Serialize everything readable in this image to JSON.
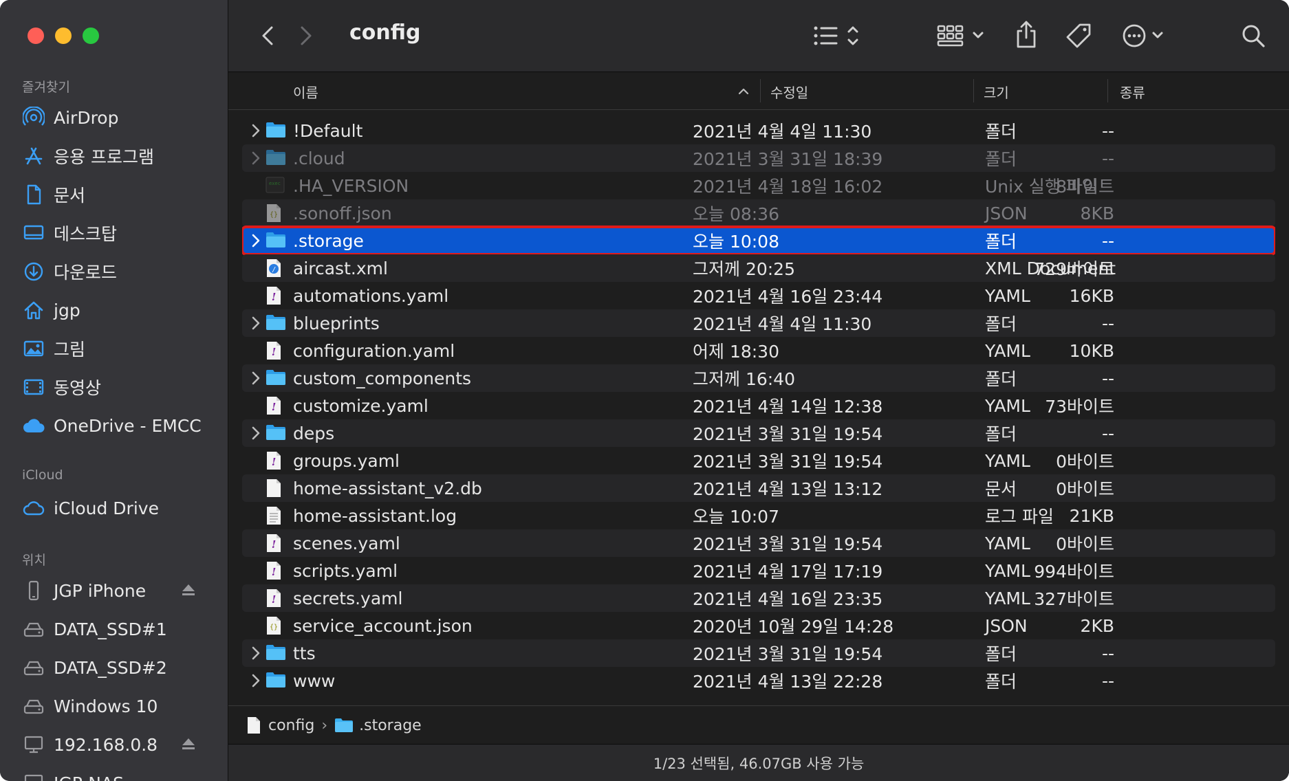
{
  "window": {
    "title": "config"
  },
  "sidebar": {
    "favorites_label": "즐겨찾기",
    "favorites": [
      {
        "label": "AirDrop",
        "icon": "airdrop-icon"
      },
      {
        "label": "응용 프로그램",
        "icon": "applications-icon"
      },
      {
        "label": "문서",
        "icon": "document-icon"
      },
      {
        "label": "데스크탑",
        "icon": "desktop-icon"
      },
      {
        "label": "다운로드",
        "icon": "download-icon"
      },
      {
        "label": "jgp",
        "icon": "home-icon"
      },
      {
        "label": "그림",
        "icon": "pictures-icon"
      },
      {
        "label": "동영상",
        "icon": "movies-icon"
      },
      {
        "label": "OneDrive - EMCC",
        "icon": "cloud-icon"
      }
    ],
    "icloud_label": "iCloud",
    "icloud": [
      {
        "label": "iCloud Drive",
        "icon": "icloud-icon"
      }
    ],
    "locations_label": "위치",
    "locations": [
      {
        "label": "JGP iPhone",
        "icon": "iphone-icon",
        "eject": true
      },
      {
        "label": "DATA_SSD#1",
        "icon": "drive-icon"
      },
      {
        "label": "DATA_SSD#2",
        "icon": "drive-icon"
      },
      {
        "label": "Windows 10",
        "icon": "drive-icon"
      },
      {
        "label": "192.168.0.8",
        "icon": "server-icon",
        "eject": true
      },
      {
        "label": "JGP-NAS",
        "icon": "server-icon"
      }
    ]
  },
  "columns": {
    "name": "이름",
    "date": "수정일",
    "size": "크기",
    "kind": "종류"
  },
  "files": [
    {
      "name": "!Default",
      "date": "2021년 4월 4일 11:30",
      "size": "--",
      "kind": "폴더",
      "type": "folder"
    },
    {
      "name": ".cloud",
      "date": "2021년 3월 31일 18:39",
      "size": "--",
      "kind": "폴더",
      "type": "folder",
      "dim": true
    },
    {
      "name": ".HA_VERSION",
      "date": "2021년 4월 18일 16:02",
      "size": "8바이트",
      "kind": "Unix 실행 파일",
      "type": "exec",
      "dim": true
    },
    {
      "name": ".sonoff.json",
      "date": "오늘 08:36",
      "size": "8KB",
      "kind": "JSON",
      "type": "json",
      "dim": true
    },
    {
      "name": ".storage",
      "date": "오늘 10:08",
      "size": "--",
      "kind": "폴더",
      "type": "folder",
      "selected": true
    },
    {
      "name": "aircast.xml",
      "date": "그저께 20:25",
      "size": "729바이트",
      "kind": "XML Document",
      "type": "xml"
    },
    {
      "name": "automations.yaml",
      "date": "2021년 4월 16일 23:44",
      "size": "16KB",
      "kind": "YAML",
      "type": "yaml"
    },
    {
      "name": "blueprints",
      "date": "2021년 4월 4일 11:30",
      "size": "--",
      "kind": "폴더",
      "type": "folder"
    },
    {
      "name": "configuration.yaml",
      "date": "어제 18:30",
      "size": "10KB",
      "kind": "YAML",
      "type": "yaml"
    },
    {
      "name": "custom_components",
      "date": "그저께 16:40",
      "size": "--",
      "kind": "폴더",
      "type": "folder"
    },
    {
      "name": "customize.yaml",
      "date": "2021년 4월 14일 12:38",
      "size": "73바이트",
      "kind": "YAML",
      "type": "yaml"
    },
    {
      "name": "deps",
      "date": "2021년 3월 31일 19:54",
      "size": "--",
      "kind": "폴더",
      "type": "folder"
    },
    {
      "name": "groups.yaml",
      "date": "2021년 3월 31일 19:54",
      "size": "0바이트",
      "kind": "YAML",
      "type": "yaml"
    },
    {
      "name": "home-assistant_v2.db",
      "date": "2021년 4월 13일 13:12",
      "size": "0바이트",
      "kind": "문서",
      "type": "blank"
    },
    {
      "name": "home-assistant.log",
      "date": "오늘 10:07",
      "size": "21KB",
      "kind": "로그 파일",
      "type": "log"
    },
    {
      "name": "scenes.yaml",
      "date": "2021년 3월 31일 19:54",
      "size": "0바이트",
      "kind": "YAML",
      "type": "yaml"
    },
    {
      "name": "scripts.yaml",
      "date": "2021년 4월 17일 17:19",
      "size": "994바이트",
      "kind": "YAML",
      "type": "yaml"
    },
    {
      "name": "secrets.yaml",
      "date": "2021년 4월 16일 23:35",
      "size": "327바이트",
      "kind": "YAML",
      "type": "yaml"
    },
    {
      "name": "service_account.json",
      "date": "2020년 10월 29일 14:28",
      "size": "2KB",
      "kind": "JSON",
      "type": "json"
    },
    {
      "name": "tts",
      "date": "2021년 3월 31일 19:54",
      "size": "--",
      "kind": "폴더",
      "type": "folder"
    },
    {
      "name": "www",
      "date": "2021년 4월 13일 22:28",
      "size": "--",
      "kind": "폴더",
      "type": "folder"
    }
  ],
  "pathbar": {
    "root": "config",
    "current": ".storage"
  },
  "status": {
    "text": "1/23 선택됨, 46.07GB 사용 가능"
  },
  "colors": {
    "selection": "#0b57d0",
    "highlight_box": "#e01b1b",
    "folder": "#3bb0f0"
  }
}
